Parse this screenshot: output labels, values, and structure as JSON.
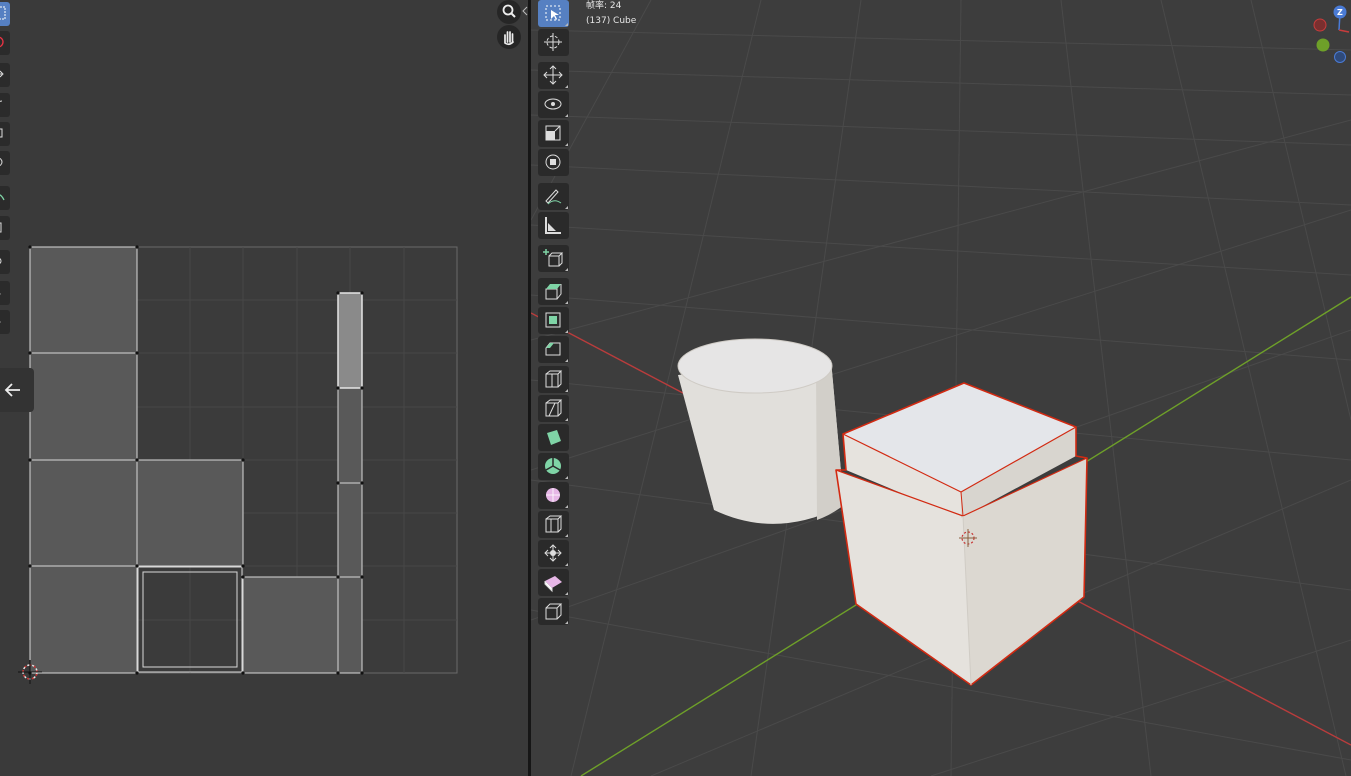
{
  "viewport": {
    "frame_rate_label": "帧率: 24",
    "object_info": "(137) Cube",
    "axis_gizmo": {
      "z_label": "Z"
    }
  },
  "colors": {
    "background_uv": "#3a3a3a",
    "background_3d": "#3d3d3d",
    "toolbar_active": "#5680c2",
    "selection_outline": "#d22a12",
    "x_axis": "#b93c3c",
    "y_axis": "#6ea029",
    "uv_face": "#5a5a5a",
    "mesh_face": "#e3e0db"
  },
  "uv_editor": {
    "toolbar_icons": [
      "select-box-icon",
      "cursor-icon",
      "move-icon",
      "rotate-icon",
      "scale-icon",
      "transform-icon",
      "annotate-icon",
      "grab-icon",
      "pinch-icon",
      "relax-icon",
      "rip-icon"
    ],
    "nav_icons": [
      "zoom-icon",
      "pan-hand-icon"
    ]
  },
  "viewport_toolbar": {
    "icons": [
      "select-box-icon",
      "cursor-icon",
      "move-icon",
      "rotate-icon",
      "scale-icon",
      "transform-icon",
      "annotate-icon",
      "measure-icon",
      "add-cube-icon",
      "extrude-icon",
      "inset-icon",
      "bevel-icon",
      "loop-cut-icon",
      "knife-icon",
      "poly-build-icon",
      "spin-icon",
      "smooth-icon",
      "edge-slide-icon",
      "shrink-fatten-icon",
      "shear-icon",
      "rip-region-icon"
    ]
  }
}
